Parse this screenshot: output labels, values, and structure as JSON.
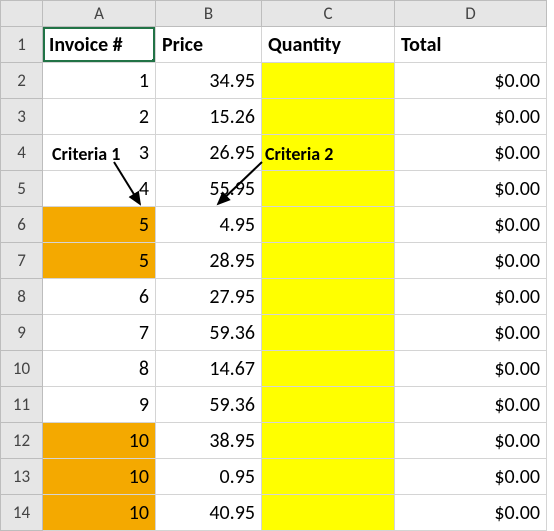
{
  "columns": [
    "A",
    "B",
    "C",
    "D"
  ],
  "row_numbers": [
    1,
    2,
    3,
    4,
    5,
    6,
    7,
    8,
    9,
    10,
    11,
    12,
    13,
    14
  ],
  "headers": {
    "A": "Invoice #",
    "B": "Price",
    "C": "Quantity",
    "D": "Total"
  },
  "active_cell": "A1",
  "highlight_orange_rows": [
    6,
    7,
    12,
    13,
    14
  ],
  "highlight_yellow_column": "C",
  "annotations": {
    "criteria1": {
      "text": "Criteria 1"
    },
    "criteria2": {
      "text": "Criteria 2"
    }
  },
  "rows": [
    {
      "invoice": "1",
      "price": "34.95",
      "quantity": "",
      "total": "$0.00"
    },
    {
      "invoice": "2",
      "price": "15.26",
      "quantity": "",
      "total": "$0.00"
    },
    {
      "invoice": "3",
      "price": "26.95",
      "quantity": "",
      "total": "$0.00"
    },
    {
      "invoice": "4",
      "price": "55.95",
      "quantity": "",
      "total": "$0.00"
    },
    {
      "invoice": "5",
      "price": "4.95",
      "quantity": "",
      "total": "$0.00"
    },
    {
      "invoice": "5",
      "price": "28.95",
      "quantity": "",
      "total": "$0.00"
    },
    {
      "invoice": "6",
      "price": "27.95",
      "quantity": "",
      "total": "$0.00"
    },
    {
      "invoice": "7",
      "price": "59.36",
      "quantity": "",
      "total": "$0.00"
    },
    {
      "invoice": "8",
      "price": "14.67",
      "quantity": "",
      "total": "$0.00"
    },
    {
      "invoice": "9",
      "price": "59.36",
      "quantity": "",
      "total": "$0.00"
    },
    {
      "invoice": "10",
      "price": "38.95",
      "quantity": "",
      "total": "$0.00"
    },
    {
      "invoice": "10",
      "price": "0.95",
      "quantity": "",
      "total": "$0.00"
    },
    {
      "invoice": "10",
      "price": "40.95",
      "quantity": "",
      "total": "$0.00"
    }
  ],
  "chart_data": {
    "type": "table",
    "title": "",
    "columns": [
      "Invoice #",
      "Price",
      "Quantity",
      "Total"
    ],
    "rows": [
      [
        1,
        34.95,
        null,
        0.0
      ],
      [
        2,
        15.26,
        null,
        0.0
      ],
      [
        3,
        26.95,
        null,
        0.0
      ],
      [
        4,
        55.95,
        null,
        0.0
      ],
      [
        5,
        4.95,
        null,
        0.0
      ],
      [
        5,
        28.95,
        null,
        0.0
      ],
      [
        6,
        27.95,
        null,
        0.0
      ],
      [
        7,
        59.36,
        null,
        0.0
      ],
      [
        8,
        14.67,
        null,
        0.0
      ],
      [
        9,
        59.36,
        null,
        0.0
      ],
      [
        10,
        38.95,
        null,
        0.0
      ],
      [
        10,
        0.95,
        null,
        0.0
      ],
      [
        10,
        40.95,
        null,
        0.0
      ]
    ]
  }
}
